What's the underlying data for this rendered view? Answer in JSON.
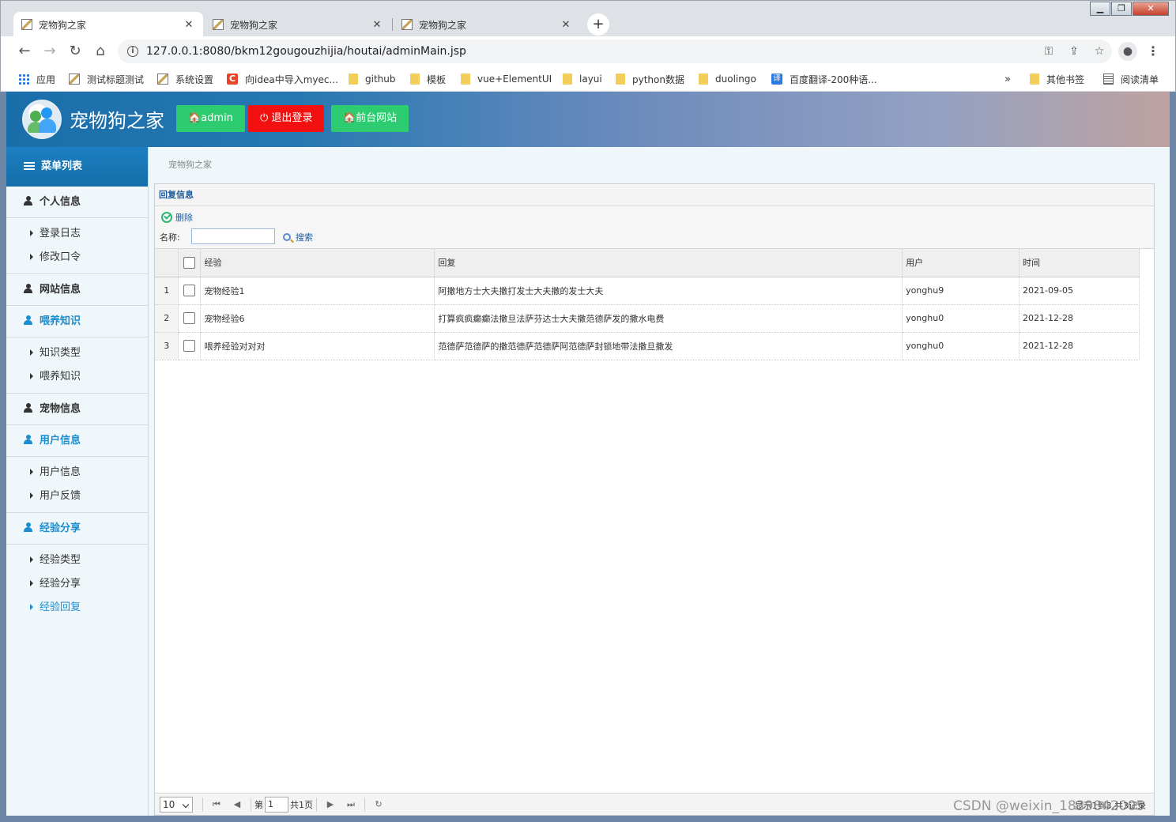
{
  "browser": {
    "tabs": [
      {
        "title": "宠物狗之家",
        "active": true
      },
      {
        "title": "宠物狗之家",
        "active": false
      },
      {
        "title": "宠物狗之家",
        "active": false
      }
    ],
    "new_tab": "+",
    "close_glyph": "✕",
    "url": "127.0.0.1:8080/bkm12gougouzhijia/houtai/adminMain.jsp",
    "bookmarks": [
      {
        "label": "应用",
        "icon": "apps-grid-icon"
      },
      {
        "label": "测试标题测试",
        "icon": "site-favicon"
      },
      {
        "label": "系统设置",
        "icon": "site-favicon"
      },
      {
        "label": "向idea中导入myec...",
        "icon": "c-logo-icon"
      },
      {
        "label": "github",
        "icon": "folder-icon"
      },
      {
        "label": "模板",
        "icon": "folder-icon"
      },
      {
        "label": "vue+ElementUI",
        "icon": "folder-icon"
      },
      {
        "label": "layui",
        "icon": "folder-icon"
      },
      {
        "label": "python数据",
        "icon": "folder-icon"
      },
      {
        "label": "duolingo",
        "icon": "folder-icon"
      },
      {
        "label": "百度翻译-200种语...",
        "icon": "translate-icon"
      }
    ],
    "overflow": "»",
    "other_bookmarks": "其他书签",
    "reading_list": "阅读清单"
  },
  "header": {
    "site_title": "宠物狗之家",
    "buttons": [
      "🏠admin",
      "⏻ 退出登录",
      "🏠前台网站"
    ]
  },
  "sidebar": {
    "title": "菜单列表",
    "groups": [
      {
        "label": "个人信息",
        "highlight": false,
        "items": [
          {
            "label": "登录日志"
          },
          {
            "label": "修改口令"
          }
        ]
      },
      {
        "label": "网站信息",
        "highlight": false,
        "items": []
      },
      {
        "label": "喂养知识",
        "highlight": true,
        "items": [
          {
            "label": "知识类型"
          },
          {
            "label": "喂养知识"
          }
        ]
      },
      {
        "label": "宠物信息",
        "highlight": false,
        "items": []
      },
      {
        "label": "用户信息",
        "highlight": true,
        "items": [
          {
            "label": "用户信息"
          },
          {
            "label": "用户反馈"
          }
        ]
      },
      {
        "label": "经验分享",
        "highlight": true,
        "items": [
          {
            "label": "经验类型"
          },
          {
            "label": "经验分享"
          },
          {
            "label": "经验回复",
            "active": true
          }
        ]
      }
    ]
  },
  "main": {
    "breadcrumb": "宠物狗之家",
    "panel_title": "回复信息",
    "delete_label": "删除",
    "search_label": "名称:",
    "search_value": "",
    "search_button": "搜索",
    "columns": [
      "经验",
      "回复",
      "用户",
      "时间"
    ],
    "rows": [
      {
        "num": "1",
        "exp": "宠物经验1",
        "reply": "阿撒地方士大夫撒打发士大夫撒的发士大夫",
        "user": "yonghu9",
        "time": "2021-09-05"
      },
      {
        "num": "2",
        "exp": "宠物经验6",
        "reply": "打算疯疯癫癫法撒旦法萨芬达士大夫撒范德萨发的撒水电费",
        "user": "yonghu0",
        "time": "2021-12-28"
      },
      {
        "num": "3",
        "exp": "喂养经验对对对",
        "reply": "范德萨范德萨的撒范德萨范德萨阿范德萨封锁地带法撒旦撒发",
        "user": "yonghu0",
        "time": "2021-12-28"
      }
    ],
    "pager": {
      "page_size": "10",
      "page_prefix": "第",
      "page_value": "1",
      "total_pages": "共1页",
      "info": "显示1到3,共3记录"
    }
  },
  "watermark": "CSDN @weixin_1839842005"
}
